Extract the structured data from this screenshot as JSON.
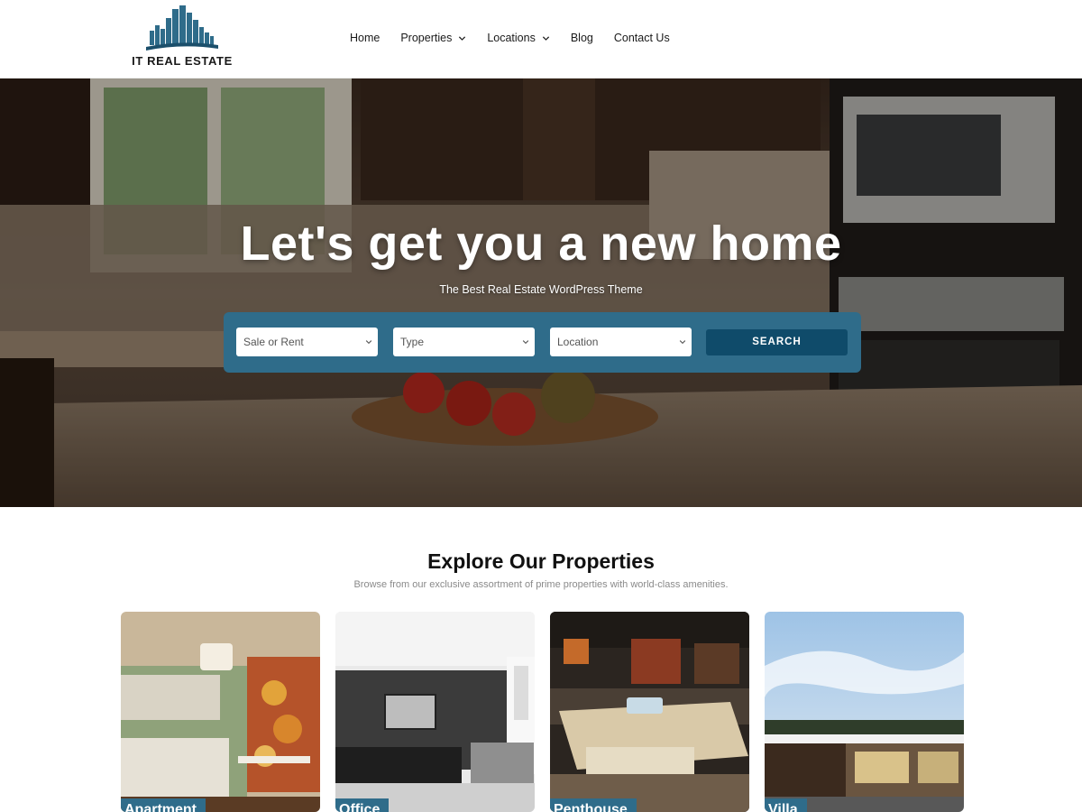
{
  "brand": {
    "name": "IT REAL ESTATE"
  },
  "nav": {
    "items": [
      {
        "label": "Home",
        "has_dropdown": false
      },
      {
        "label": "Properties",
        "has_dropdown": true
      },
      {
        "label": "Locations",
        "has_dropdown": true
      },
      {
        "label": "Blog",
        "has_dropdown": false
      },
      {
        "label": "Contact Us",
        "has_dropdown": false
      }
    ]
  },
  "hero": {
    "title": "Let's get you a new home",
    "subtitle": "The Best Real Estate WordPress Theme",
    "search": {
      "sale_or_rent": "Sale or Rent",
      "type": "Type",
      "location": "Location",
      "button": "SEARCH"
    }
  },
  "explore": {
    "title": "Explore Our Properties",
    "subtitle": "Browse from our exclusive assortment of prime properties with world-class amenities.",
    "cards": [
      {
        "label": "Apartment"
      },
      {
        "label": "Office"
      },
      {
        "label": "Penthouse"
      },
      {
        "label": "Villa"
      }
    ]
  },
  "colors": {
    "accent": "#2f6c8a",
    "accent_dark": "#0f4b6a"
  },
  "icons": {
    "logo": "city-skyline-icon",
    "dropdown": "chevron-down-icon"
  }
}
